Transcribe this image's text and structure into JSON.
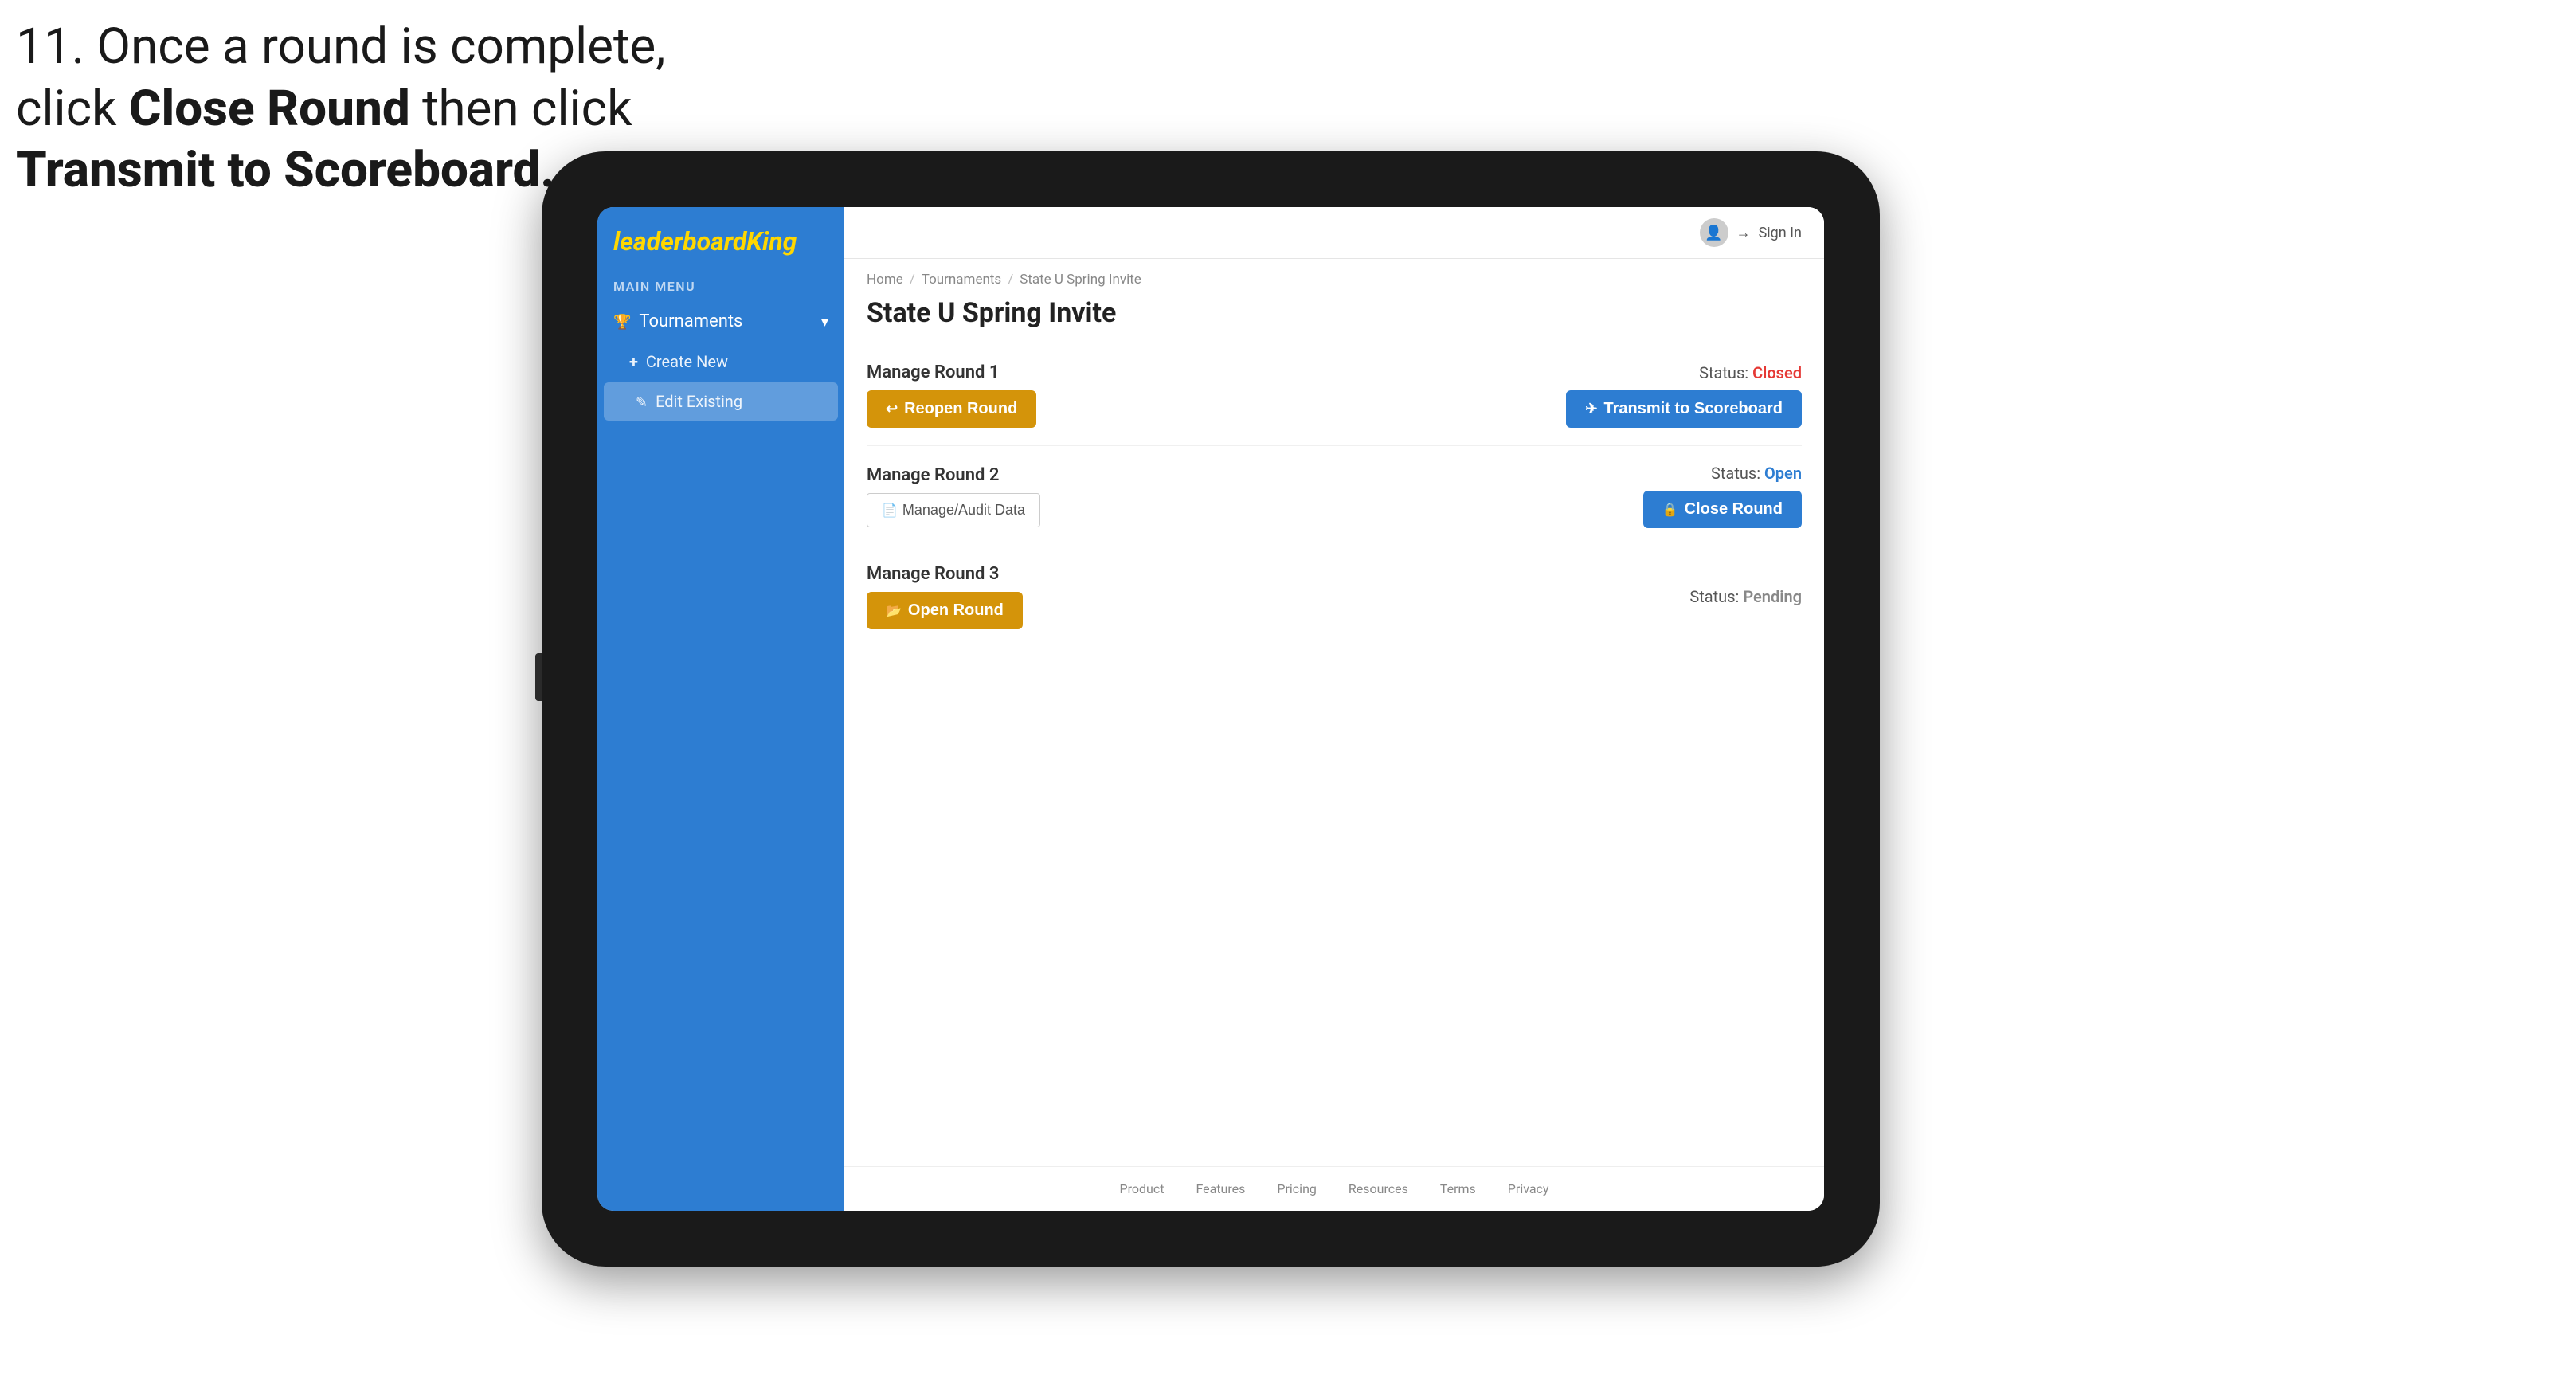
{
  "instruction": {
    "line1": "11. Once a round is complete,",
    "line2": "click ",
    "bold1": "Close Round",
    "line3": " then click",
    "bold2": "Transmit to Scoreboard."
  },
  "app": {
    "logo": {
      "prefix": "leaderboard",
      "suffix": "King"
    },
    "topbar": {
      "signin_label": "Sign In"
    },
    "sidebar": {
      "main_menu_label": "MAIN MENU",
      "items": [
        {
          "label": "Tournaments",
          "expanded": true
        },
        {
          "label": "Create New"
        },
        {
          "label": "Edit Existing"
        }
      ]
    },
    "breadcrumb": {
      "home": "Home",
      "tournaments": "Tournaments",
      "current": "State U Spring Invite"
    },
    "page_title": "State U Spring Invite",
    "rounds": [
      {
        "title": "Manage Round 1",
        "status_label": "Status:",
        "status_value": "Closed",
        "status_type": "closed",
        "primary_button": "Reopen Round",
        "secondary_button": "Transmit to Scoreboard"
      },
      {
        "title": "Manage Round 2",
        "status_label": "Status:",
        "status_value": "Open",
        "status_type": "open",
        "primary_button": "Manage/Audit Data",
        "secondary_button": "Close Round"
      },
      {
        "title": "Manage Round 3",
        "status_label": "Status:",
        "status_value": "Pending",
        "status_type": "pending",
        "primary_button": "Open Round",
        "secondary_button": null
      }
    ],
    "footer": {
      "links": [
        "Product",
        "Features",
        "Pricing",
        "Resources",
        "Terms",
        "Privacy"
      ]
    }
  }
}
